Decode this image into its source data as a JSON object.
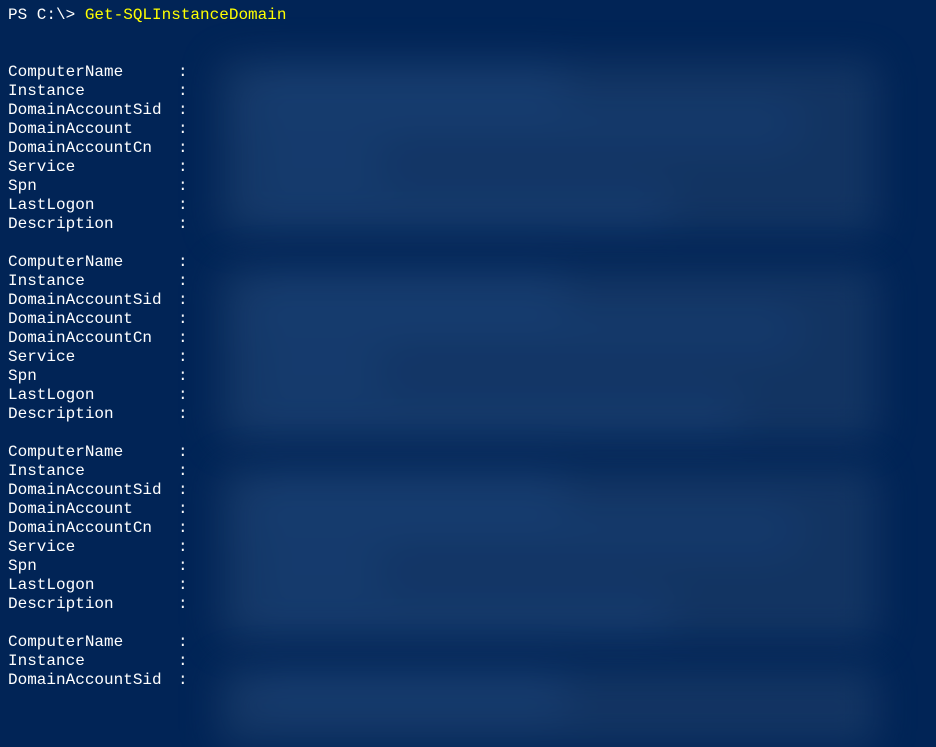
{
  "prompt": "PS C:\\> ",
  "command": "Get-SQLInstanceDomain",
  "fields": [
    "ComputerName",
    "Instance",
    "DomainAccountSid",
    "DomainAccount",
    "DomainAccountCn",
    "Service",
    "Spn",
    "LastLogon",
    "Description"
  ],
  "partialFields": [
    "ComputerName",
    "Instance",
    "DomainAccountSid"
  ],
  "separator": ":",
  "fullBlocks": 3
}
